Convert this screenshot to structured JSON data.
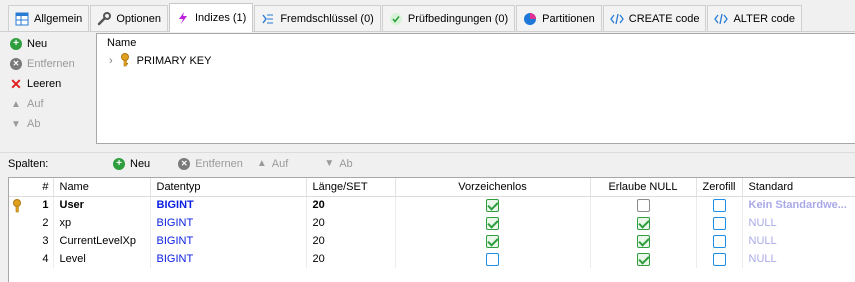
{
  "tabs": [
    {
      "label": "Allgemein",
      "icon": "table-icon",
      "active": false
    },
    {
      "label": "Optionen",
      "icon": "wrench-icon",
      "active": false
    },
    {
      "label": "Indizes (1)",
      "icon": "lightning-icon",
      "active": true
    },
    {
      "label": "Fremdschlüssel (0)",
      "icon": "foreign-key-icon",
      "active": false
    },
    {
      "label": "Prüfbedingungen (0)",
      "icon": "check-icon",
      "active": false
    },
    {
      "label": "Partitionen",
      "icon": "pie-icon",
      "active": false
    },
    {
      "label": "CREATE code",
      "icon": "code-icon",
      "active": false
    },
    {
      "label": "ALTER code",
      "icon": "code-icon",
      "active": false
    }
  ],
  "index_toolbar": {
    "new": "Neu",
    "remove": "Entfernen",
    "clear": "Leeren",
    "up": "Auf",
    "down": "Ab"
  },
  "index_panel": {
    "header": "Name",
    "rows": [
      {
        "label": "PRIMARY KEY"
      }
    ]
  },
  "columns_toolbar": {
    "label": "Spalten:",
    "new": "Neu",
    "remove": "Entfernen",
    "up": "Auf",
    "down": "Ab"
  },
  "columns_table": {
    "headers": [
      "#",
      "Name",
      "Datentyp",
      "Länge/SET",
      "Vorzeichenlos",
      "Erlaube NULL",
      "Zerofill",
      "Standard"
    ],
    "rows": [
      {
        "num": "1",
        "name": "User",
        "type": "BIGINT",
        "length": "20",
        "unsigned": true,
        "allow_null": false,
        "zerofill": false,
        "default": "Kein Standardwe...",
        "primary": true
      },
      {
        "num": "2",
        "name": "xp",
        "type": "BIGINT",
        "length": "20",
        "unsigned": true,
        "allow_null": true,
        "zerofill": false,
        "default": "NULL",
        "primary": false
      },
      {
        "num": "3",
        "name": "CurrentLevelXp",
        "type": "BIGINT",
        "length": "20",
        "unsigned": true,
        "allow_null": true,
        "zerofill": false,
        "default": "NULL",
        "primary": false
      },
      {
        "num": "4",
        "name": "Level",
        "type": "BIGINT",
        "length": "20",
        "unsigned": false,
        "allow_null": true,
        "zerofill": false,
        "default": "NULL",
        "primary": false
      }
    ]
  },
  "colors": {
    "type_blue": "#0a1fe0",
    "check_green": "#2e9e3e",
    "zerofill_blue": "#1c8ee6",
    "default_muted": "#a9a9e8",
    "key_gold": "#e0a020"
  }
}
